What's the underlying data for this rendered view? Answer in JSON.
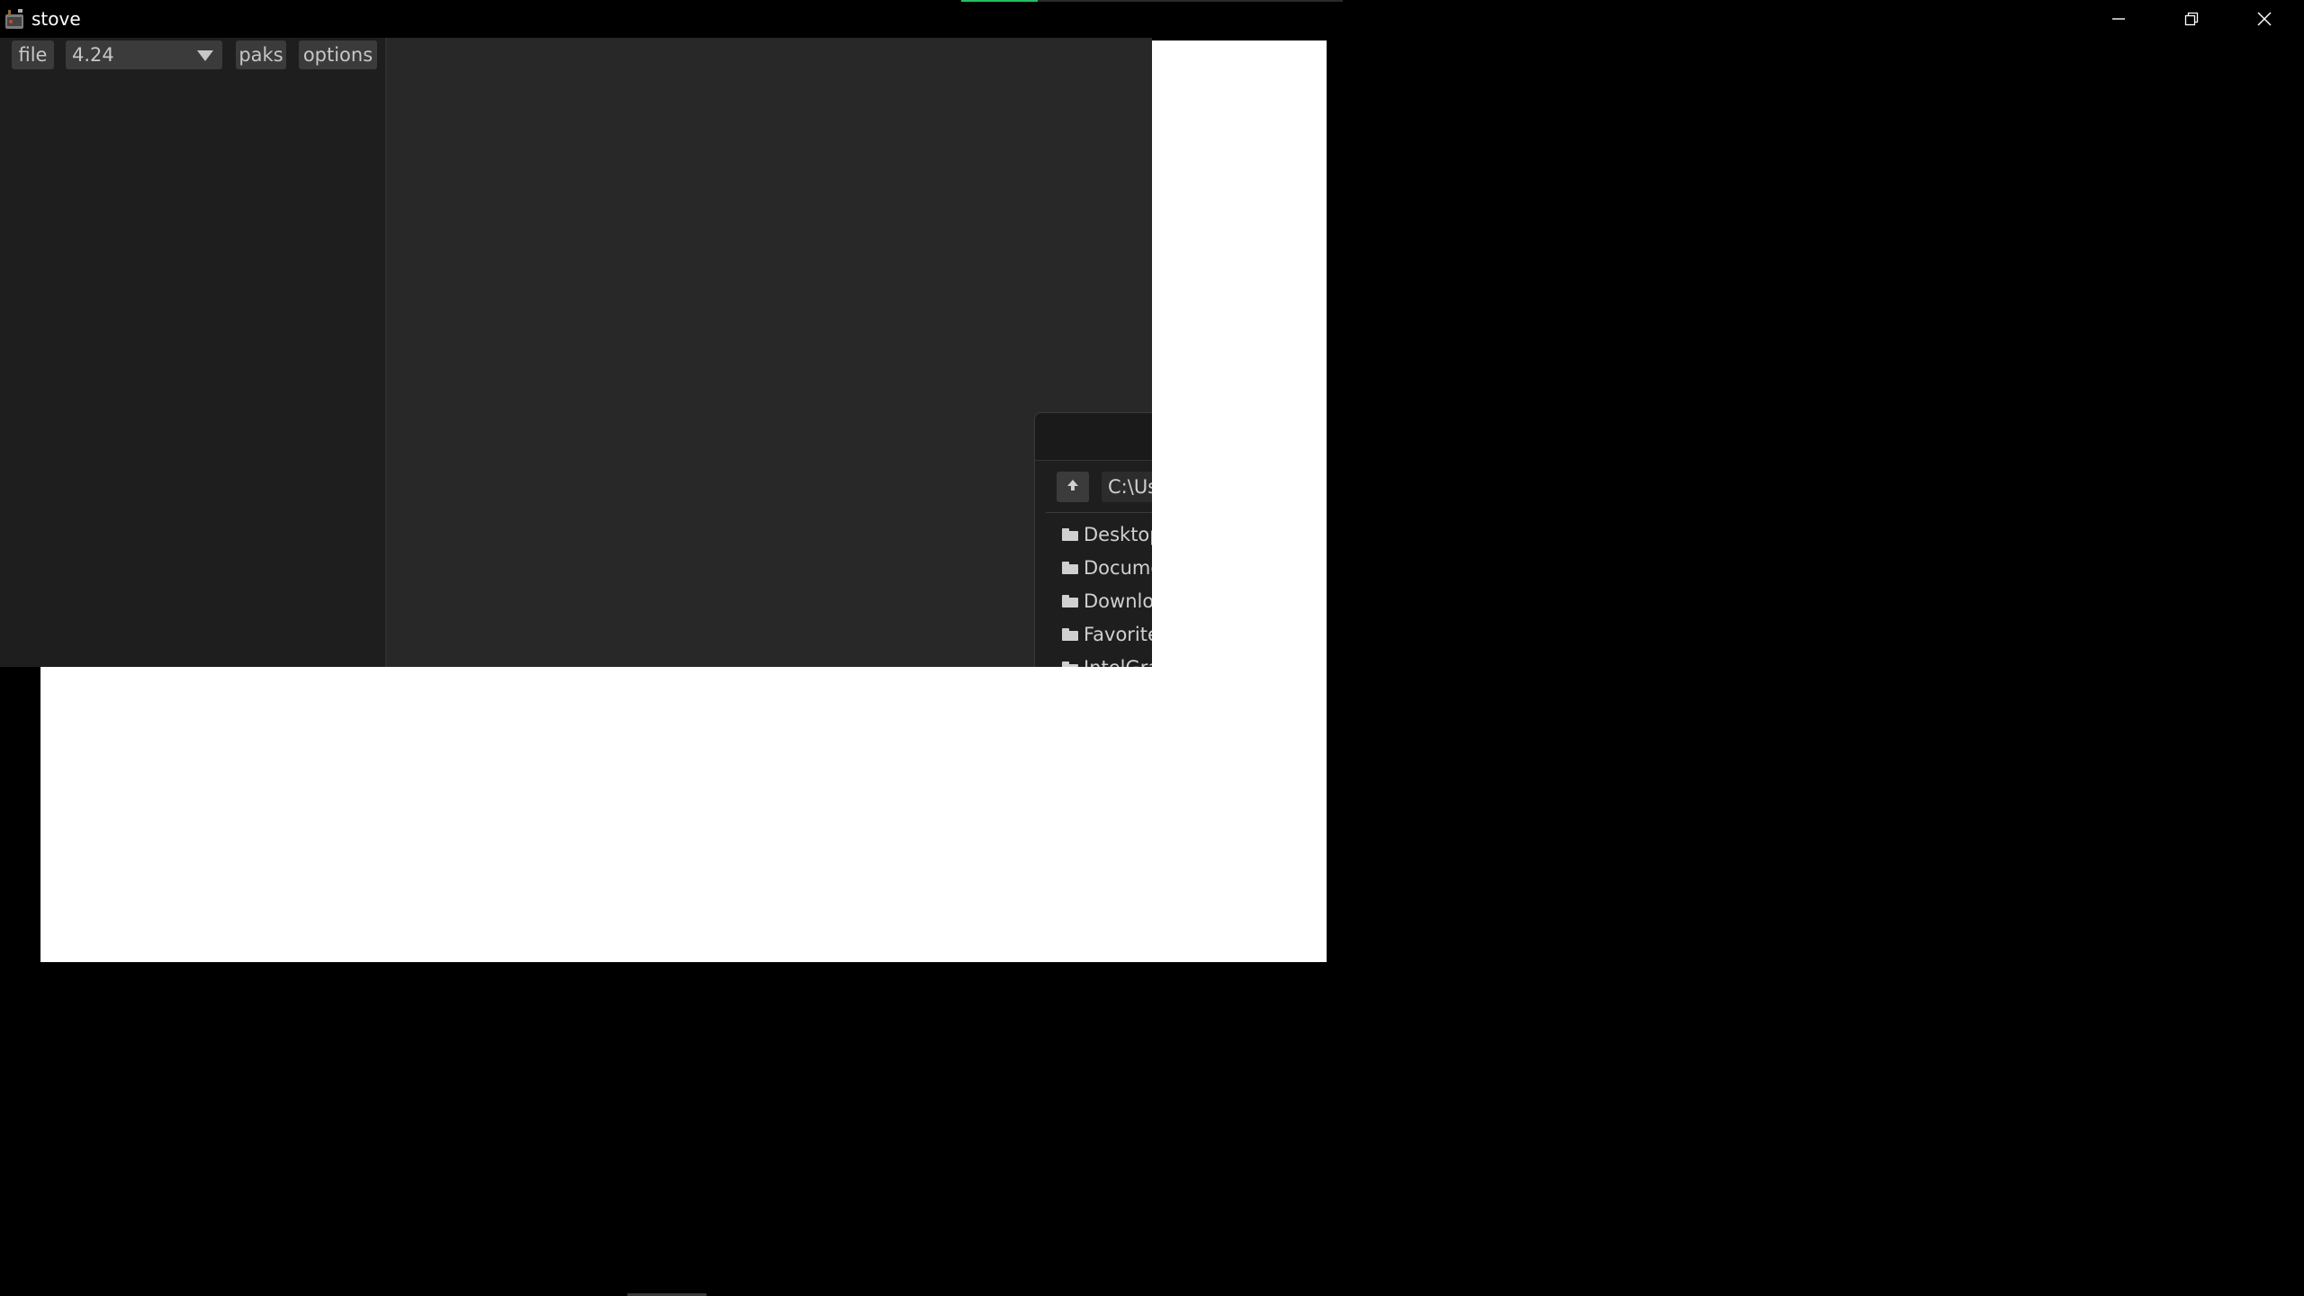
{
  "window": {
    "title": "stove",
    "icon": "stove-app-icon",
    "controls": {
      "minimize_icon": "minimize-icon",
      "maximize_icon": "restore-icon",
      "close_icon": "close-icon"
    },
    "top_progress": {
      "fraction": 0.2,
      "color": "#21c25e"
    }
  },
  "menubar": {
    "file_label": "file",
    "version_selected": "4.24",
    "paks_label": "paks",
    "options_label": "options"
  },
  "file_dialog": {
    "path": "C:\\Us",
    "up_icon": "arrow-up-icon",
    "folders": [
      {
        "label": "Desktop",
        "icon": "folder-icon"
      },
      {
        "label": "Docume",
        "icon": "folder-icon"
      },
      {
        "label": "Downlo",
        "icon": "folder-icon"
      },
      {
        "label": "Favorite",
        "icon": "folder-icon"
      },
      {
        "label": "IntelGra",
        "icon": "folder-icon"
      }
    ]
  },
  "colors": {
    "titlebar_bg": "#000000",
    "panel_bg": "#1e1e1e",
    "main_bg": "#282828",
    "button_bg": "#3b3b3b",
    "text": "#c7c7c7"
  }
}
